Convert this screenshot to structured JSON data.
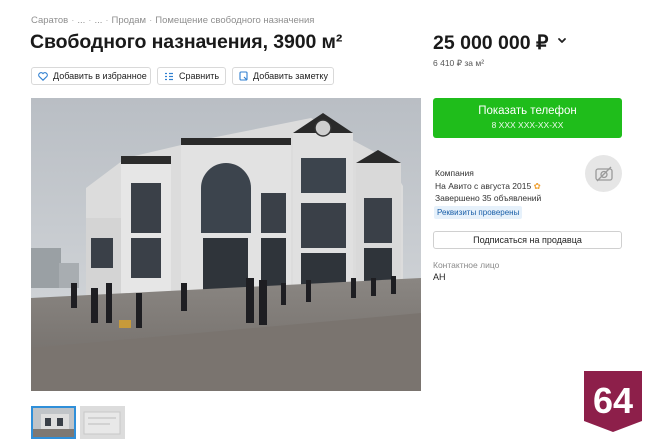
{
  "breadcrumbs": [
    "Саратов",
    "...",
    "...",
    "Продам",
    "Помещение свободного назначения"
  ],
  "listing": {
    "title": "Свободного назначения, 3900 м²",
    "price": "25 000 000 ₽",
    "price_per_m2": "6 410 ₽ за м²"
  },
  "actions": {
    "favorite": "Добавить в избранное",
    "compare": "Сравнить",
    "note": "Добавить заметку"
  },
  "call": {
    "label": "Показать телефон",
    "masked_phone": "8 XXX XXX-XX-XX"
  },
  "seller": {
    "type": "Компания",
    "since": "На Авито с августа 2015",
    "completed": "Завершено 35 объявлений",
    "verified_badge": "Реквизиты проверены",
    "subscribe_label": "Подписаться на продавца",
    "contact_label": "Контактное лицо",
    "contact_value": "АН"
  },
  "watermark": "64",
  "colors": {
    "accent_green": "#1fbd1b",
    "link_blue": "#1a5fa8",
    "logo_red": "#8d1f4a"
  },
  "icons": [
    "chevron-down-icon",
    "heart-icon",
    "compare-icon",
    "note-icon",
    "medal-icon",
    "avatar-placeholder-icon"
  ]
}
